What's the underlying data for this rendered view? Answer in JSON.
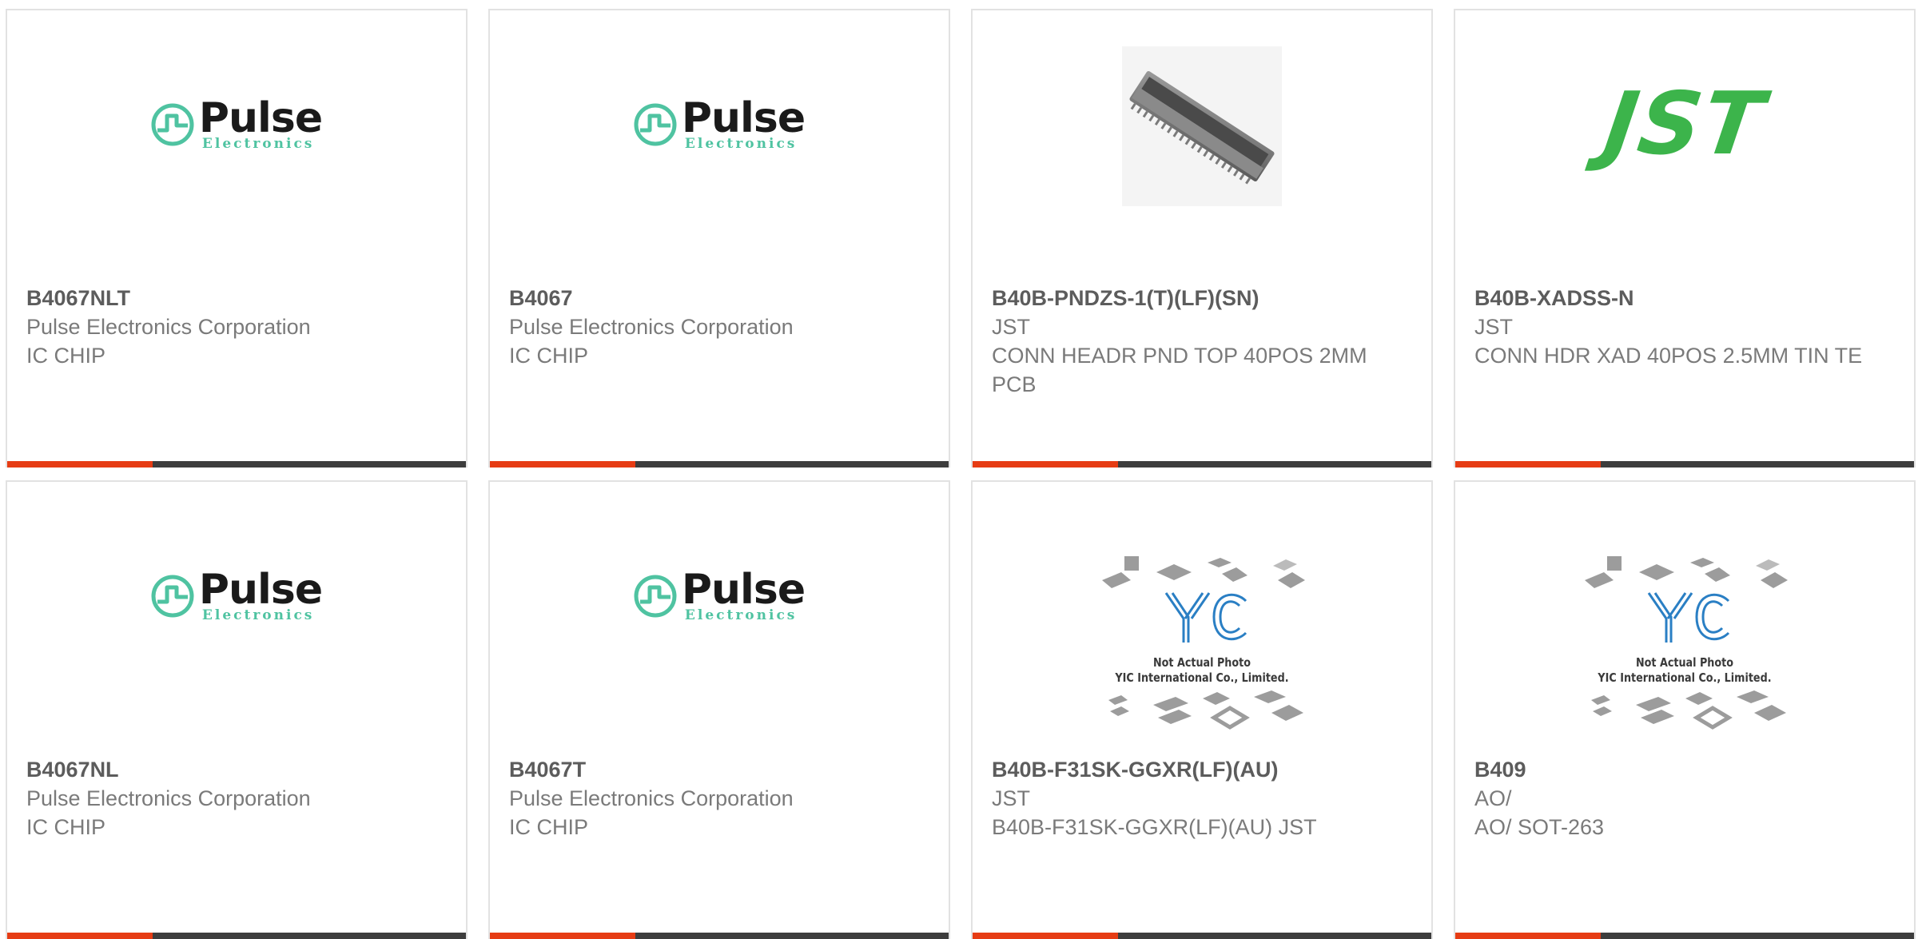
{
  "products": [
    {
      "part_number": "B4067NLT",
      "manufacturer": "Pulse Electronics Corporation",
      "description": "IC CHIP",
      "image": {
        "type": "pulse-logo",
        "word": "Pulse",
        "sub": "Electronics"
      }
    },
    {
      "part_number": "B4067",
      "manufacturer": "Pulse Electronics Corporation",
      "description": "IC CHIP",
      "image": {
        "type": "pulse-logo",
        "word": "Pulse",
        "sub": "Electronics"
      }
    },
    {
      "part_number": "B40B-PNDZS-1(T)(LF)(SN)",
      "manufacturer": "JST",
      "description": "CONN HEADR PND TOP 40POS 2MM PCB",
      "image": {
        "type": "connector-photo"
      }
    },
    {
      "part_number": "B40B-XADSS-N",
      "manufacturer": "JST",
      "description": "CONN HDR XAD 40POS 2.5MM TIN TE",
      "image": {
        "type": "jst-logo",
        "word": "JST"
      }
    },
    {
      "part_number": "B4067NL",
      "manufacturer": "Pulse Electronics Corporation",
      "description": "IC CHIP",
      "image": {
        "type": "pulse-logo",
        "word": "Pulse",
        "sub": "Electronics"
      }
    },
    {
      "part_number": "B4067T",
      "manufacturer": "Pulse Electronics Corporation",
      "description": "IC CHIP",
      "image": {
        "type": "pulse-logo",
        "word": "Pulse",
        "sub": "Electronics"
      }
    },
    {
      "part_number": "B40B-F31SK-GGXR(LF)(AU)",
      "manufacturer": "JST",
      "description": "B40B-F31SK-GGXR(LF)(AU) JST",
      "image": {
        "type": "yic-placeholder",
        "line1": "Not Actual Photo",
        "line2": "YIC International Co., Limited."
      }
    },
    {
      "part_number": "B409",
      "manufacturer": "AO/",
      "description": "AO/ SOT-263",
      "image": {
        "type": "yic-placeholder",
        "line1": "Not Actual Photo",
        "line2": "YIC International Co., Limited."
      }
    }
  ],
  "colors": {
    "accent": "#e63c14",
    "bar": "#3d3d3d",
    "pulse_green": "#4fc3a1",
    "jst_green": "#3cb44b",
    "yic_blue": "#2a7fc4"
  }
}
